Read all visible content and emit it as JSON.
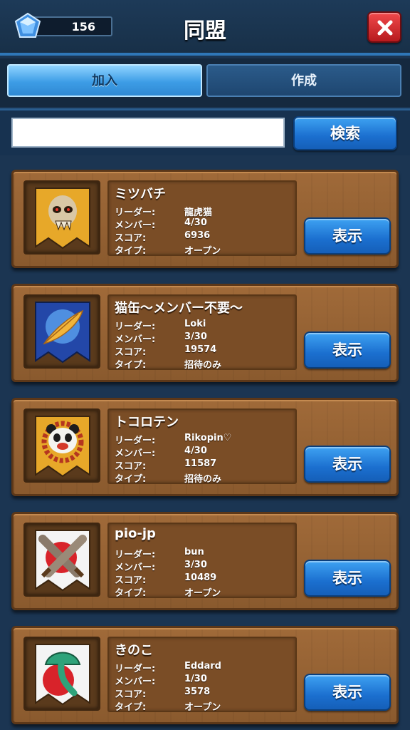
{
  "header": {
    "gems": "156",
    "title": "同盟",
    "gem_icon": "diamond-gem-icon",
    "close_icon": "close-icon"
  },
  "tabs": [
    {
      "label": "加入",
      "active": true
    },
    {
      "label": "作成",
      "active": false
    }
  ],
  "search": {
    "value": "",
    "placeholder": "",
    "button_label": "検索"
  },
  "labels": {
    "leader": "リーダー:",
    "members": "メンバー:",
    "score": "スコア:",
    "type": "タイプ:",
    "view_button": "表示"
  },
  "alliances": [
    {
      "name": "ミツバチ",
      "leader": "龍虎猫",
      "members": "4/30",
      "score": "6936",
      "type": "オープン",
      "emblem": "skull-emblem-icon"
    },
    {
      "name": "猫缶〜メンバー不要〜",
      "leader": "Loki",
      "members": "3/30",
      "score": "19574",
      "type": "招待のみ",
      "emblem": "feather-emblem-icon"
    },
    {
      "name": "トコロテン",
      "leader": "Rikopin♡",
      "members": "4/30",
      "score": "11587",
      "type": "招待のみ",
      "emblem": "panda-emblem-icon"
    },
    {
      "name": "pio-jp",
      "leader": "bun",
      "members": "3/30",
      "score": "10489",
      "type": "オープン",
      "emblem": "crossed-swords-emblem-icon"
    },
    {
      "name": "きのこ",
      "leader": "Eddard",
      "members": "1/30",
      "score": "3578",
      "type": "オープン",
      "emblem": "mushroom-emblem-icon"
    }
  ],
  "colors": {
    "background": "#1b3552",
    "card_wood": "#8a5a2e",
    "button_blue": "#1b6fcf",
    "close_red": "#d12a2e"
  }
}
